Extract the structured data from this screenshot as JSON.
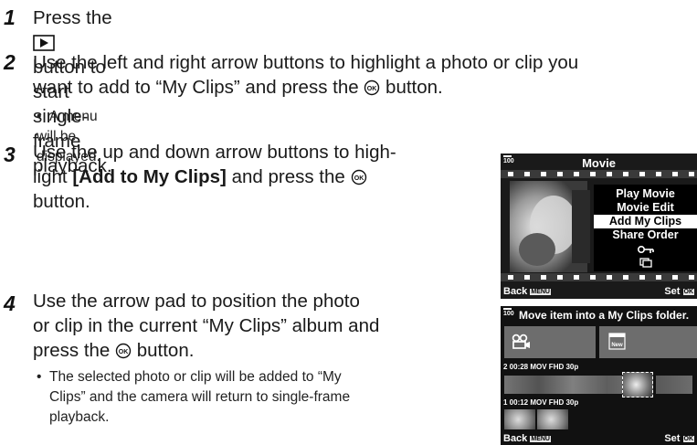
{
  "steps": [
    {
      "num": "1",
      "pre": "Press the",
      "post": "button to start single-frame playback."
    },
    {
      "num": "2",
      "line1_pre": "Use the left and right arrow buttons to highlight a photo or clip you",
      "line2_pre": "want to add to “My Clips” and press the",
      "line2_post": "button.",
      "bullet": "A menu will be displayed."
    },
    {
      "num": "3",
      "line1": "Use the up and down arrow buttons to high-",
      "line2_pre": "light",
      "line2_bold": "[Add to My Clips]",
      "line2_mid": "and press the",
      "line3": "button."
    },
    {
      "num": "4",
      "line1": "Use the arrow pad to position the photo",
      "line2": "or clip in the current “My Clips” album and",
      "line3_pre": "press the",
      "line3_post": "button.",
      "bullet_lines": [
        "The selected photo or clip will be added to “My",
        "Clips” and the camera will return to single-frame",
        "playback."
      ]
    }
  ],
  "screen1": {
    "counter": "100",
    "title": "Movie",
    "menu": [
      "Play Movie",
      "Movie Edit",
      "Add My Clips",
      "Share Order",
      "key-icon",
      "protect-icon"
    ],
    "selected_index": 2,
    "back": "Back",
    "back_badge": "MENU",
    "set": "Set"
  },
  "screen2": {
    "counter": "100",
    "header": "Move item into a My Clips folder.",
    "row1_info": "2 00:28  MOV  FHD 30p",
    "row2_info": "1 00:12  MOV  FHD 30p",
    "new_label": "New",
    "back": "Back",
    "back_badge": "MENU",
    "set": "Set"
  },
  "colors": {
    "text": "#1a1a1a",
    "screen_bg": "#111111",
    "selected_bg": "#ffffff"
  }
}
